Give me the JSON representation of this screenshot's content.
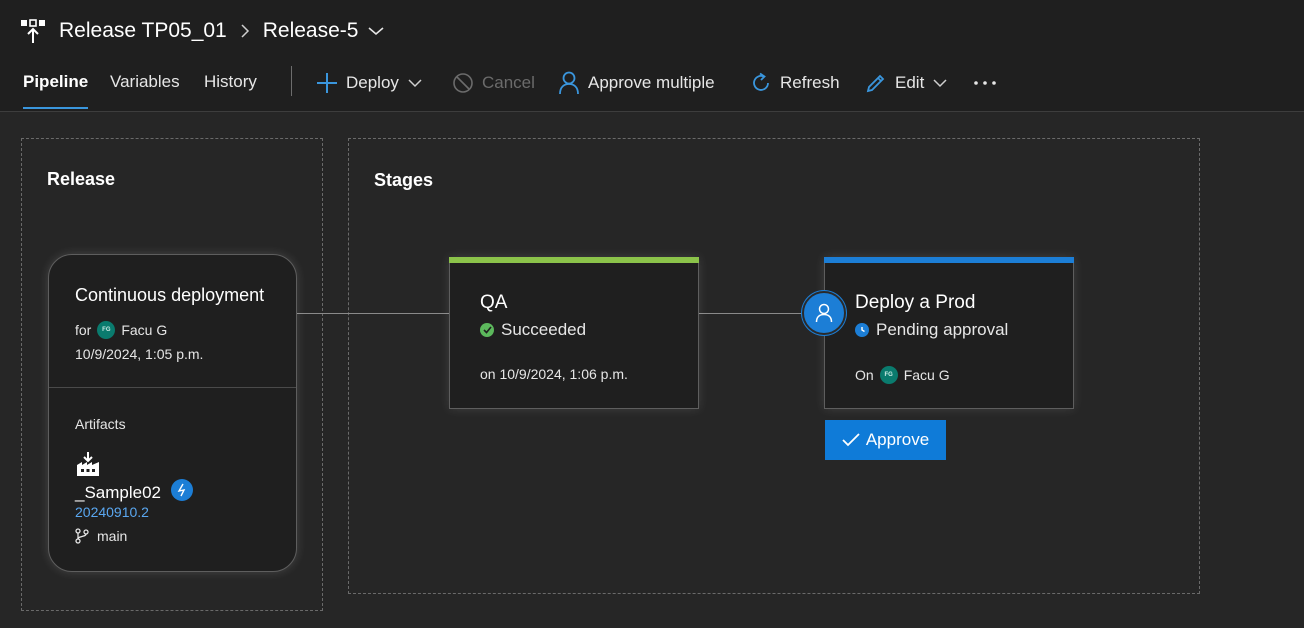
{
  "header": {
    "release_name": "Release TP05_01",
    "release_instance": "Release-5"
  },
  "tabs": [
    {
      "label": "Pipeline",
      "active": true
    },
    {
      "label": "Variables",
      "active": false
    },
    {
      "label": "History",
      "active": false
    }
  ],
  "commands": {
    "deploy": "Deploy",
    "cancel": "Cancel",
    "approve_multiple": "Approve multiple",
    "refresh": "Refresh",
    "edit": "Edit"
  },
  "release_panel": {
    "title": "Release",
    "card": {
      "trigger_title": "Continuous deployment",
      "for_label": "for",
      "user_initials": "FG",
      "user_name": "Facu G",
      "datetime": "10/9/2024, 1:05 p.m.",
      "artifacts_label": "Artifacts",
      "artifact_name": "_Sample02",
      "artifact_version": "20240910.2",
      "artifact_branch": "main"
    }
  },
  "stages_panel": {
    "title": "Stages",
    "stages": [
      {
        "name": "QA",
        "status": "Succeeded",
        "status_color": "#5cb85c",
        "bar_color": "#8bc34a",
        "meta": "on 10/9/2024, 1:06 p.m."
      },
      {
        "name": "Deploy a Prod",
        "status": "Pending approval",
        "status_color": "#1c7ed6",
        "bar_color": "#1c7ed6",
        "meta_label": "On",
        "user_initials": "FG",
        "user_name": "Facu G",
        "action": "Approve"
      }
    ]
  },
  "colors": {
    "accent": "#1c7ed6",
    "success": "#8bc34a",
    "background": "#262626",
    "header_bg": "#1f1f1f"
  }
}
